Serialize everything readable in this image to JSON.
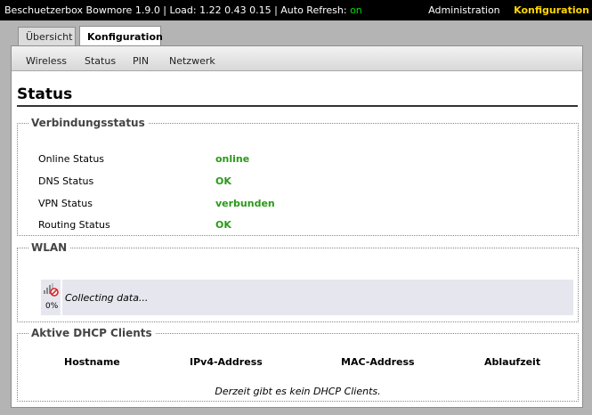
{
  "topbar": {
    "info_prefix": "Beschuetzerbox Bowmore 1.9.0 | Load: 1.22 0.43 0.15 | Auto Refresh: ",
    "auto_refresh": "on",
    "menu": [
      "Administration",
      "Konfiguration"
    ]
  },
  "tabs": [
    "Übersicht",
    "Konfiguration"
  ],
  "subnav": [
    "Wireless",
    "Status",
    "PIN",
    "Netzwerk"
  ],
  "page_title": "Status",
  "connection": {
    "legend": "Verbindungsstatus",
    "rows": [
      {
        "label": "Online Status",
        "value": "online"
      },
      {
        "label": "DNS Status",
        "value": "OK"
      },
      {
        "label": "VPN Status",
        "value": "verbunden"
      },
      {
        "label": "Routing Status",
        "value": "OK"
      }
    ],
    "value_color": "#2a9a18"
  },
  "wlan": {
    "legend": "WLAN",
    "progress": "0%",
    "message": "Collecting data..."
  },
  "dhcp": {
    "legend": "Aktive DHCP Clients",
    "columns": [
      "Hostname",
      "IPv4-Address",
      "MAC-Address",
      "Ablaufzeit"
    ],
    "empty_message": "Derzeit gibt es kein DHCP Clients."
  }
}
